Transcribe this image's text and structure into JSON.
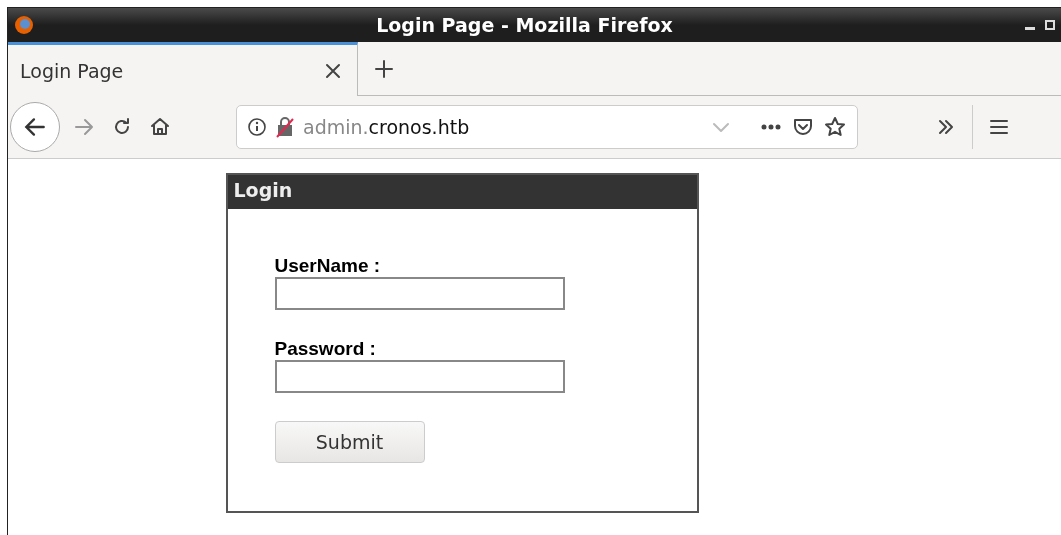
{
  "window": {
    "title": "Login Page - Mozilla Firefox"
  },
  "tabs": [
    {
      "label": "Login Page",
      "selected": true
    }
  ],
  "address_bar": {
    "url_subdomain": "admin.",
    "url_domain": "cronos.htb"
  },
  "login_form": {
    "title": "Login",
    "fields": [
      {
        "label": "UserName :"
      },
      {
        "label": "Password :"
      }
    ],
    "submit": "Submit"
  }
}
